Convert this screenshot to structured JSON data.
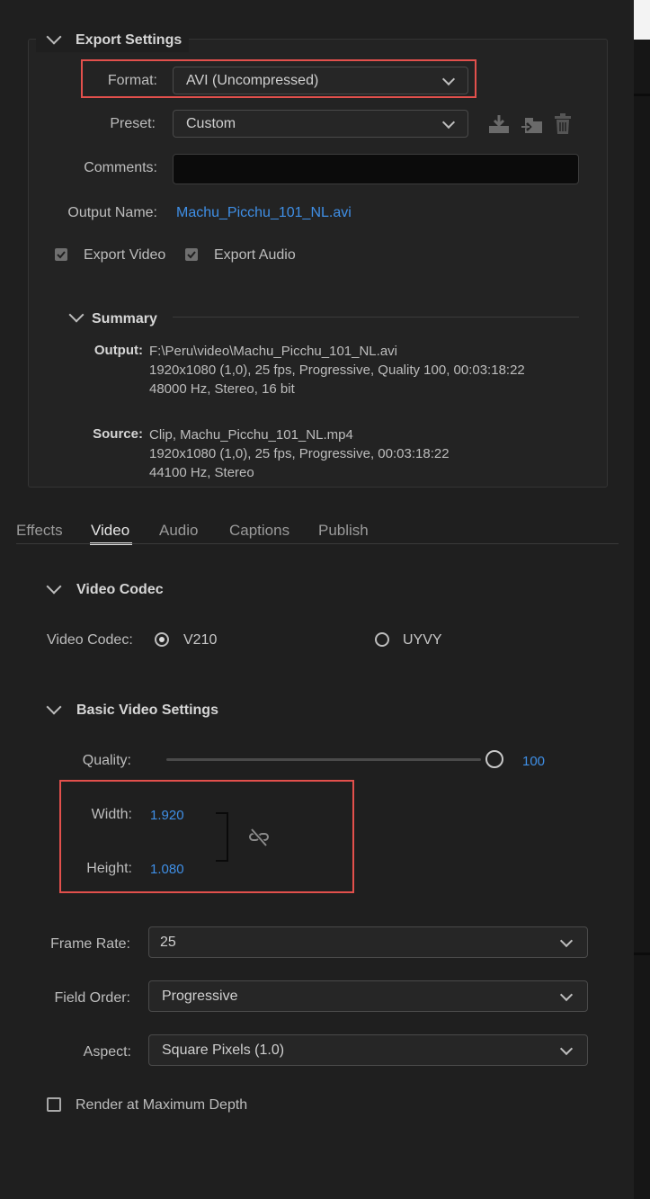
{
  "export_settings": {
    "title": "Export Settings",
    "format_label": "Format:",
    "format_value": "AVI (Uncompressed)",
    "preset_label": "Preset:",
    "preset_value": "Custom",
    "comments_label": "Comments:",
    "comments_value": "",
    "output_name_label": "Output Name:",
    "output_name_value": "Machu_Picchu_101_NL.avi",
    "export_video_label": "Export Video",
    "export_video_checked": true,
    "export_audio_label": "Export Audio",
    "export_audio_checked": true,
    "icons": [
      "save-preset-icon",
      "import-preset-icon",
      "delete-preset-icon"
    ]
  },
  "summary": {
    "title": "Summary",
    "output_label": "Output:",
    "output_lines": [
      "F:\\Peru\\video\\Machu_Picchu_101_NL.avi",
      "1920x1080 (1,0), 25 fps, Progressive, Quality 100, 00:03:18:22",
      "48000 Hz, Stereo, 16 bit"
    ],
    "source_label": "Source:",
    "source_lines": [
      "Clip, Machu_Picchu_101_NL.mp4",
      "1920x1080 (1,0), 25 fps, Progressive, 00:03:18:22",
      "44100 Hz, Stereo"
    ]
  },
  "tabs": [
    "Effects",
    "Video",
    "Audio",
    "Captions",
    "Publish"
  ],
  "active_tab": "Video",
  "video_codec": {
    "title": "Video Codec",
    "label": "Video Codec:",
    "options": [
      "V210",
      "UYVY"
    ],
    "selected": "V210"
  },
  "basic_video": {
    "title": "Basic Video Settings",
    "quality_label": "Quality:",
    "quality_value": "100",
    "quality_fraction": 1.0,
    "width_label": "Width:",
    "width_value": "1.920",
    "height_label": "Height:",
    "height_value": "1.080",
    "frame_rate_label": "Frame Rate:",
    "frame_rate_value": "25",
    "field_order_label": "Field Order:",
    "field_order_value": "Progressive",
    "aspect_label": "Aspect:",
    "aspect_value": "Square Pixels (1.0)",
    "render_max_depth_label": "Render at Maximum Depth",
    "render_max_depth_checked": false
  },
  "colors": {
    "background": "#1f1f1f",
    "link": "#3f8fe6",
    "highlight_box": "#e2504c"
  }
}
